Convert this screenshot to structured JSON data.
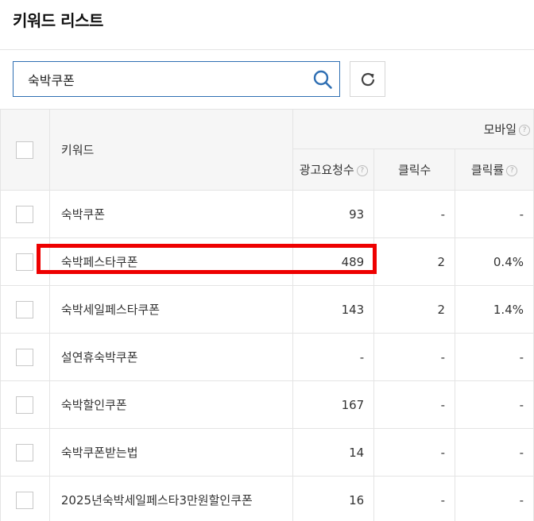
{
  "page": {
    "title": "키워드 리스트"
  },
  "search": {
    "value": "숙박쿠폰"
  },
  "table": {
    "headers": {
      "keyword": "키워드",
      "group_mobile": "모바일",
      "impressions": "광고요청수",
      "clicks": "클릭수",
      "ctr": "클릭률",
      "help_glyph": "?"
    },
    "rows": [
      {
        "keyword": "숙박쿠폰",
        "impressions": "93",
        "clicks": "-",
        "ctr": "-"
      },
      {
        "keyword": "숙박페스타쿠폰",
        "impressions": "489",
        "clicks": "2",
        "ctr": "0.4%"
      },
      {
        "keyword": "숙박세일페스타쿠폰",
        "impressions": "143",
        "clicks": "2",
        "ctr": "1.4%"
      },
      {
        "keyword": "설연휴숙박쿠폰",
        "impressions": "-",
        "clicks": "-",
        "ctr": "-"
      },
      {
        "keyword": "숙박할인쿠폰",
        "impressions": "167",
        "clicks": "-",
        "ctr": "-"
      },
      {
        "keyword": "숙박쿠폰받는법",
        "impressions": "14",
        "clicks": "-",
        "ctr": "-"
      },
      {
        "keyword": "2025년숙박세일페스타3만원할인쿠폰",
        "impressions": "16",
        "clicks": "-",
        "ctr": "-"
      }
    ]
  },
  "colors": {
    "accent": "#2f6fb3",
    "highlight": "#ee0000"
  }
}
